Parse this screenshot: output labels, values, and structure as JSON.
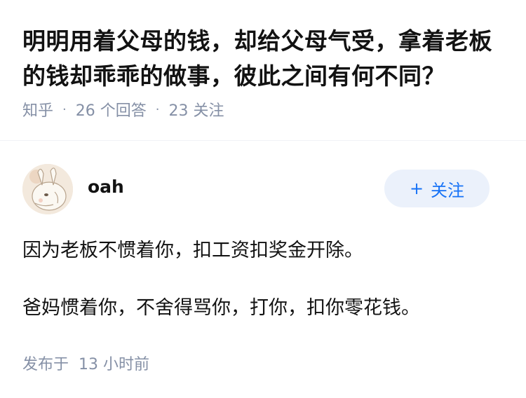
{
  "question": {
    "title": "明明用着父母的钱，却给父母气受，拿着老板的钱却乖乖的做事，彼此之间有何不同？",
    "source": "知乎",
    "answer_count": "26 个回答",
    "follower_count": "23 关注",
    "separator": "·"
  },
  "author": {
    "name": "oah",
    "avatar_icon": "avatar-illustration",
    "follow_label": "关注",
    "follow_icon": "+"
  },
  "answer": {
    "paragraphs": [
      "因为老板不惯着你，扣工资扣奖金开除。",
      "爸妈惯着你，不舍得骂你，打你，扣你零花钱。"
    ]
  },
  "footer": {
    "posted_label": "发布于",
    "posted_time": "13 小时前"
  },
  "colors": {
    "text": "#121212",
    "meta": "#8590a6",
    "accent": "#1772f6",
    "button_bg": "#ebf1fb"
  }
}
